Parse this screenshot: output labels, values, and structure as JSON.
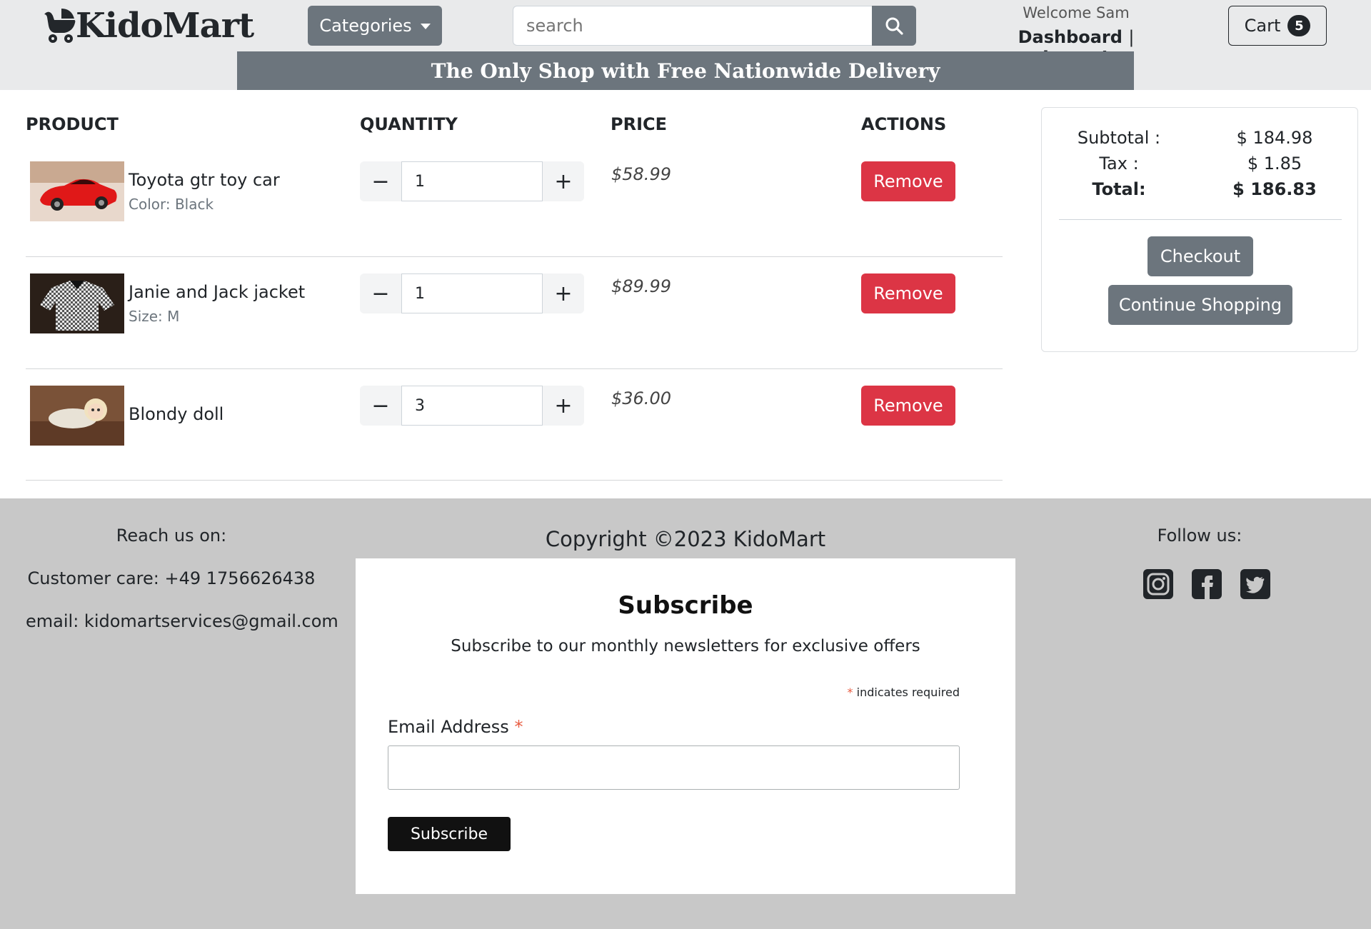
{
  "header": {
    "logo_text": "KidoMart",
    "categories_label": "Categories",
    "search_placeholder": "search",
    "welcome_text": "Welcome Sam",
    "dashboard_label": "Dashboard",
    "separator": "|",
    "logout_label": "Logout",
    "cart_label": "Cart",
    "cart_count": "5"
  },
  "banner": {
    "text": "The Only Shop with Free Nationwide Delivery"
  },
  "table": {
    "headers": [
      "PRODUCT",
      "QUANTITY",
      "PRICE",
      "ACTIONS"
    ],
    "items": [
      {
        "name": "Toyota gtr toy car",
        "variant": "Color: Black",
        "quantity": "1",
        "price": "$58.99",
        "action": "Remove"
      },
      {
        "name": "Janie and Jack jacket",
        "variant": "Size: M",
        "quantity": "1",
        "price": "$89.99",
        "action": "Remove"
      },
      {
        "name": "Blondy doll",
        "variant": "",
        "quantity": "3",
        "price": "$36.00",
        "action": "Remove"
      }
    ],
    "minus_glyph": "−",
    "plus_glyph": "+"
  },
  "summary": {
    "subtotal_label": "Subtotal :",
    "subtotal_value": "$ 184.98",
    "tax_label": "Tax :",
    "tax_value": "$ 1.85",
    "total_label": "Total:",
    "total_value": "$ 186.83",
    "checkout_label": "Checkout",
    "continue_label": "Continue Shopping"
  },
  "footer": {
    "reach_label": "Reach us on:",
    "customer_care": "Customer care: +49 1756626438",
    "email_prefix": "email:",
    "email_value": "kidomartservices@gmail.com",
    "copyright": "Copyright ©2023 KidoMart",
    "follow_label": "Follow us:",
    "social_icons": [
      "instagram-icon",
      "facebook-icon",
      "twitter-icon"
    ]
  },
  "subscribe": {
    "title": "Subscribe",
    "text": "Subscribe to our monthly newsletters for exclusive offers",
    "required_star": "*",
    "required_note": "indicates required",
    "email_label": "Email Address",
    "button_label": "Subscribe"
  },
  "colors": {
    "header_bg": "#e9eaeb",
    "secondary": "#6c757d",
    "danger": "#dc3545",
    "footer_bg": "#c8c8c8",
    "dark": "#212529"
  }
}
